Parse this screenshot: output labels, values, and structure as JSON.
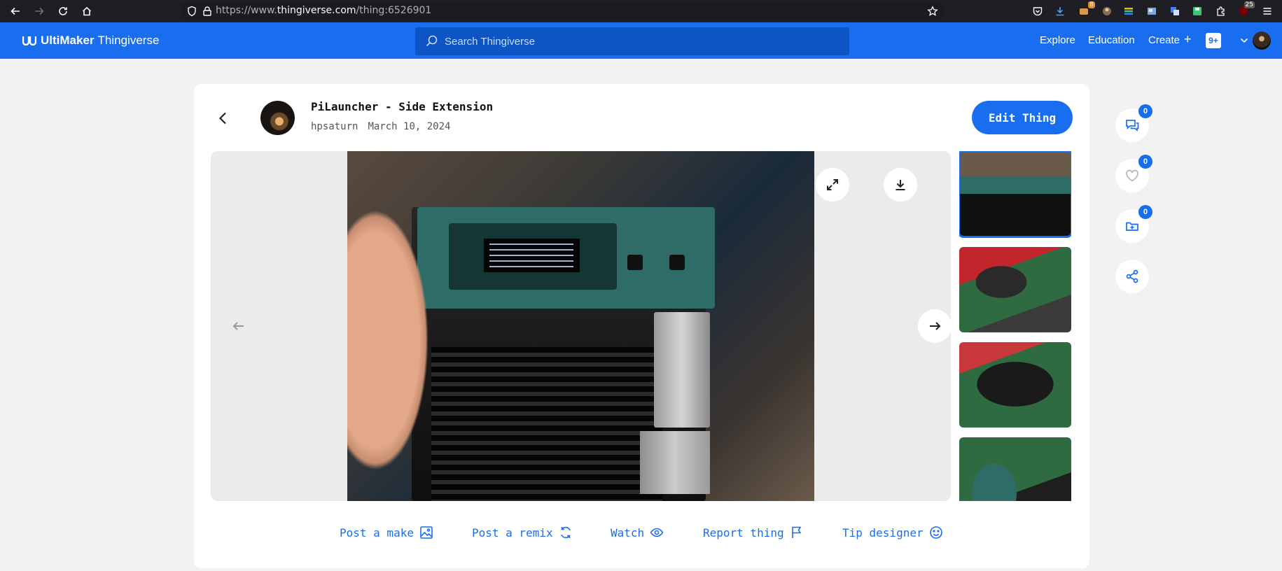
{
  "browser": {
    "url_prefix": "https://www.",
    "url_domain": "thingiverse.com",
    "url_path": "/thing:6526901",
    "downloads_badge": "8",
    "extension_badge": "25"
  },
  "header": {
    "brand": "UltiMaker",
    "brand_sub": "Thingiverse",
    "search_placeholder": "Search Thingiverse",
    "nav": [
      "Explore",
      "Education",
      "Create"
    ],
    "notifications": "9+"
  },
  "thing": {
    "title": "PiLauncher - Side Extension",
    "author": "hpsaturn",
    "date": "March 10, 2024",
    "edit_label": "Edit Thing"
  },
  "actions": {
    "post_make": "Post a make",
    "post_remix": "Post a remix",
    "watch": "Watch",
    "report": "Report thing",
    "tip": "Tip designer"
  },
  "rail": {
    "comments": "0",
    "likes": "0",
    "collections": "0"
  },
  "colors": {
    "accent": "#196ef0",
    "browser_bg": "#1f1e25"
  }
}
